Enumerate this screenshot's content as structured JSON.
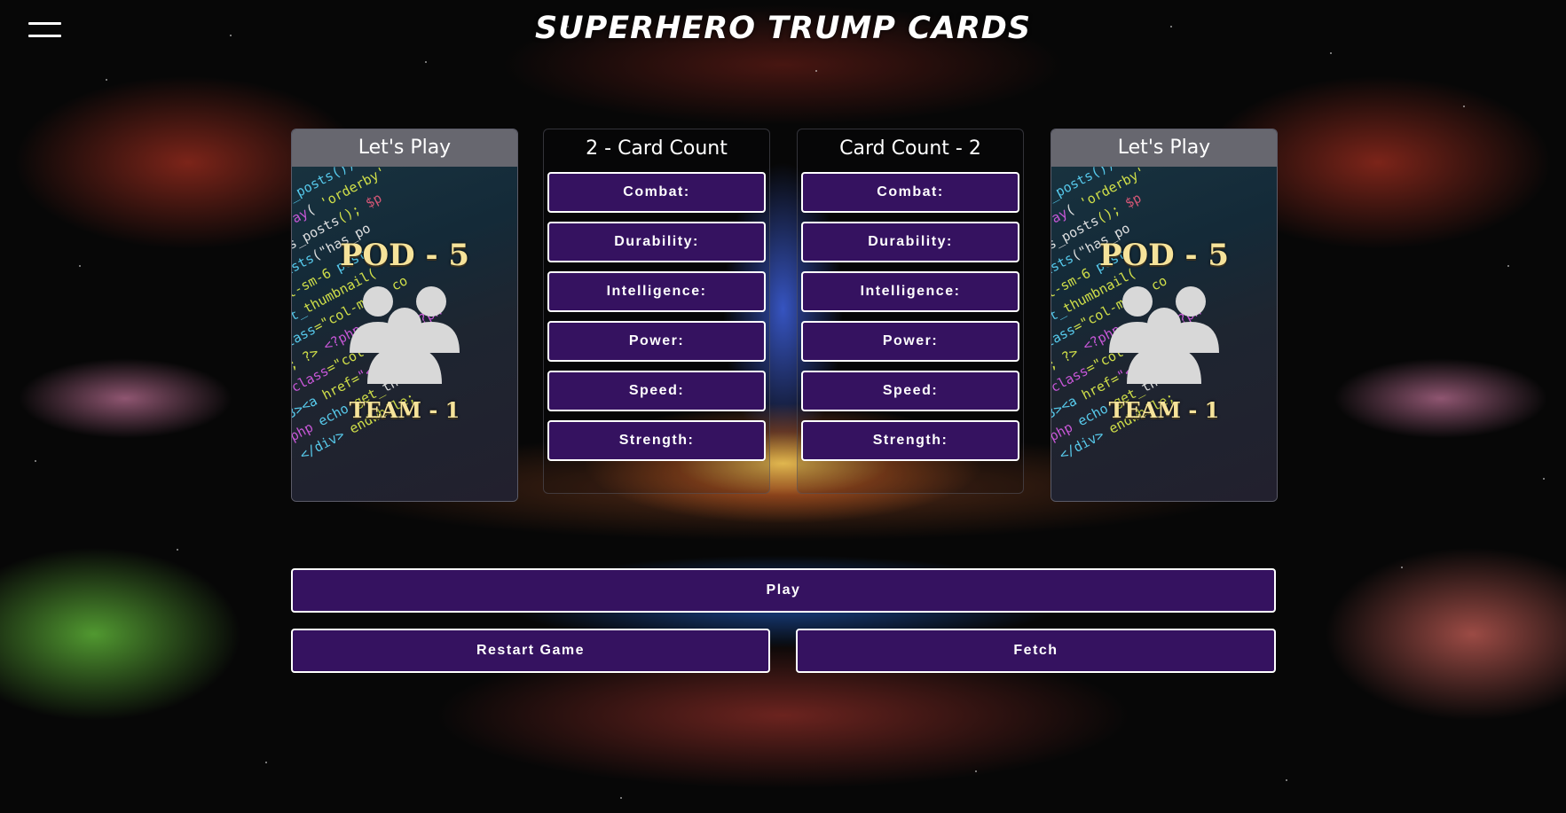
{
  "header": {
    "title": "SUPERHERO TRUMP CARDS",
    "menu_icon": "hamburger-menu-icon"
  },
  "player_card": {
    "header": "Let's Play",
    "image_title": "POD - 5",
    "image_subtitle": "TEAM - 1",
    "image_icon": "team-group-icon"
  },
  "opponent_card": {
    "header": "Let's Play",
    "image_title": "POD - 5",
    "image_subtitle": "TEAM - 1",
    "image_icon": "team-group-icon"
  },
  "player_stats": {
    "header": "2 - Card Count",
    "items": [
      {
        "label": "Combat:"
      },
      {
        "label": "Durability:"
      },
      {
        "label": "Intelligence:"
      },
      {
        "label": "Power:"
      },
      {
        "label": "Speed:"
      },
      {
        "label": "Strength:"
      }
    ]
  },
  "opponent_stats": {
    "header": "Card Count - 2",
    "items": [
      {
        "label": "Combat:"
      },
      {
        "label": "Durability:"
      },
      {
        "label": "Intelligence:"
      },
      {
        "label": "Power:"
      },
      {
        "label": "Speed:"
      },
      {
        "label": "Strength:"
      }
    ]
  },
  "actions": {
    "play": "Play",
    "restart": "Restart Game",
    "fetch": "Fetch"
  },
  "colors": {
    "button_bg": "#351260",
    "button_border": "#ffffff"
  }
}
